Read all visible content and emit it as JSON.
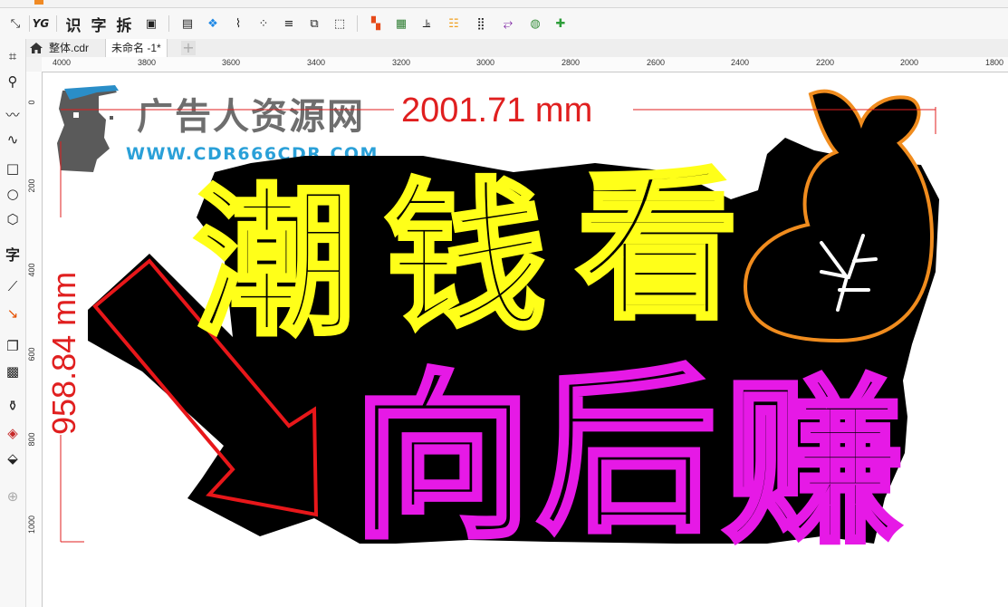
{
  "menu": {
    "items": [
      "",
      "",
      "",
      "",
      "",
      "",
      "",
      "",
      ""
    ]
  },
  "toolbar": {
    "text_tools": [
      "识",
      "字",
      "拆"
    ]
  },
  "tabs": [
    {
      "label": "整体.cdr",
      "active": false
    },
    {
      "label": "未命名 -1*",
      "active": true
    }
  ],
  "ruler": {
    "horizontal": [
      "4000",
      "3800",
      "3600",
      "3400",
      "3200",
      "3000",
      "2800",
      "2600",
      "2400",
      "2200",
      "2000",
      "1800"
    ],
    "vertical": [
      "0",
      "200",
      "400",
      "600",
      "800",
      "1000"
    ]
  },
  "watermark": {
    "cn": "广告人资源网",
    "url": "WWW.CDR666CDR.COM"
  },
  "dimensions": {
    "width": "2001.71 mm",
    "height": "958.84 mm",
    "color": "#e01f1f"
  },
  "artwork": {
    "line1": [
      "潮",
      "钱",
      "看"
    ],
    "line2": [
      "向",
      "后",
      "赚"
    ],
    "colors": {
      "yellow": "#ffff19",
      "magenta": "#e619e6",
      "orange": "#f08c1e",
      "red": "#e8171a",
      "background": "#000000"
    },
    "money_symbol": "¥"
  }
}
